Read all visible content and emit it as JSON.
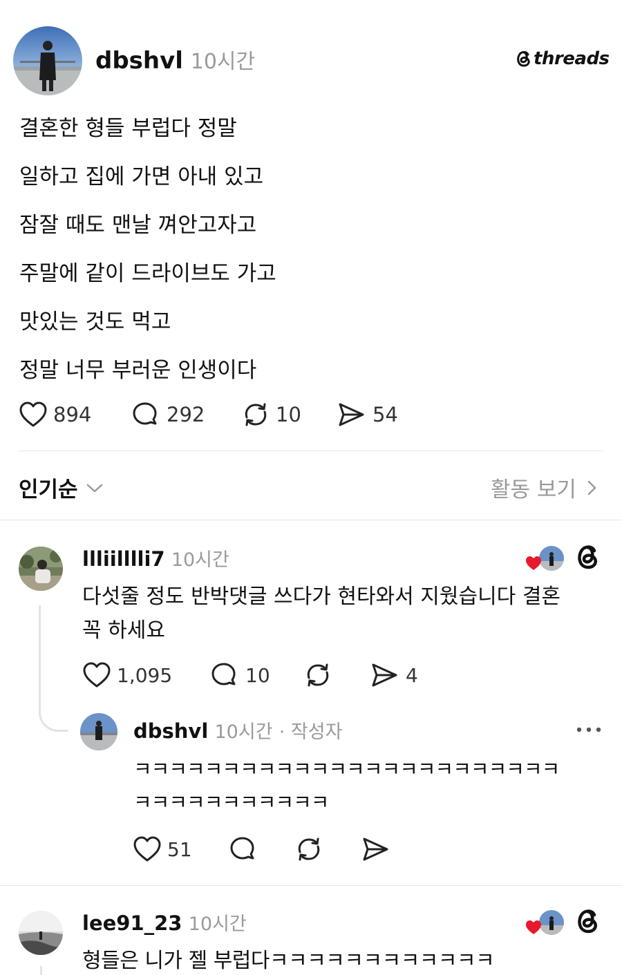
{
  "post": {
    "username": "dbshvl",
    "time": "10시간",
    "brand": "threads",
    "lines": [
      "결혼한 형들 부럽다 정말",
      "일하고 집에 가면 아내 있고",
      "잠잘 때도 맨날 껴안고자고",
      "주말에 같이 드라이브도 가고",
      "맛있는 것도 먹고",
      "정말 너무 부러운 인생이다"
    ],
    "likes": "894",
    "replies": "292",
    "reposts": "10",
    "shares": "54"
  },
  "sort": {
    "label": "인기순",
    "activity_link": "활동 보기"
  },
  "comments": [
    {
      "username": "llliilllli7",
      "time": "10시간",
      "text_line1": "다섯줄 정도 반박댓글 쓰다가 현타와서 지웠습니다 결혼",
      "text_line2": "꼭 하세요",
      "likes": "1,095",
      "replies": "10",
      "shares": "4",
      "reply": {
        "username": "dbshvl",
        "time": "10시간",
        "author_tag": "· 작성자",
        "text_line1": "ㅋㅋㅋㅋㅋㅋㅋㅋㅋㅋㅋㅋㅋㅋㅋㅋㅋㅋㅋㅋㅋㅋㅋㅋ",
        "text_line2": "ㅋㅋㅋㅋㅋㅋㅋㅋㅋㅋㅋ",
        "likes": "51"
      }
    },
    {
      "username": "lee91_23",
      "time": "10시간",
      "text_line1": "형들은 니가 젤 부럽다ㅋㅋㅋㅋㅋㅋㅋㅋㅋㅋㅋㅋ"
    }
  ],
  "colors": {
    "text": "#111111",
    "muted": "#9a9a9a",
    "divider": "#e6e6e6",
    "heart_red": "#e8192c"
  }
}
